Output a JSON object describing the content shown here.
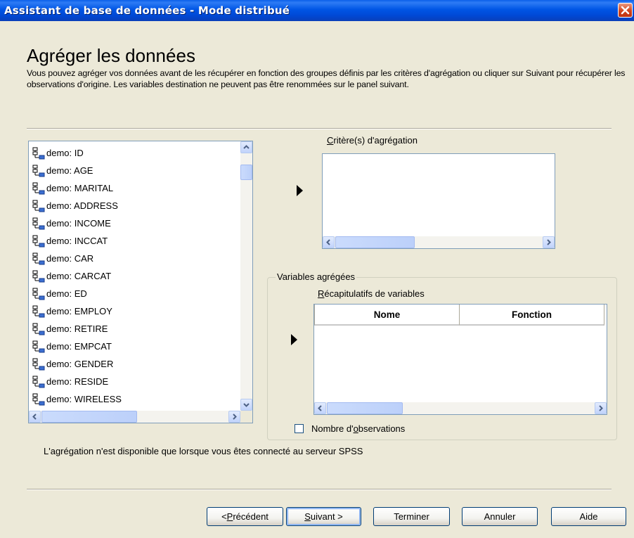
{
  "window": {
    "title": "Assistant de base de données - Mode distribué"
  },
  "page": {
    "heading": "Agréger les données",
    "description": "Vous pouvez agréger vos données avant de les récupérer en fonction des groupes définis par les critères d'agrégation ou cliquer sur Suivant pour récupérer les observations d'origine. Les variables destination ne peuvent pas être renommées sur le panel suivant."
  },
  "source_variables": [
    "demo: ID",
    "demo: AGE",
    "demo: MARITAL",
    "demo: ADDRESS",
    "demo: INCOME",
    "demo: INCCAT",
    "demo: CAR",
    "demo: CARCAT",
    "demo: ED",
    "demo: EMPLOY",
    "demo: RETIRE",
    "demo: EMPCAT",
    "demo: GENDER",
    "demo: RESIDE",
    "demo: WIRELESS"
  ],
  "criteria": {
    "label_pre": "",
    "label_u": "C",
    "label_post": "ritère(s) d'agrégation"
  },
  "aggregated": {
    "group_label": "Variables agrégées",
    "summaries_label_u": "R",
    "summaries_label_post": "écapitulatifs de variables",
    "columns": [
      "Nome",
      "Fonction"
    ],
    "count_checkbox_pre": "Nombre d'",
    "count_checkbox_u": "o",
    "count_checkbox_post": "bservations"
  },
  "footer_note": "L'agrégation n'est disponible que lorsque vous êtes connecté au serveur SPSS",
  "buttons": {
    "previous_pre": "< ",
    "previous_u": "P",
    "previous_post": "récédent",
    "next_u": "S",
    "next_post": "uivant >",
    "finish": "Terminer",
    "cancel": "Annuler",
    "help": "Aide"
  }
}
